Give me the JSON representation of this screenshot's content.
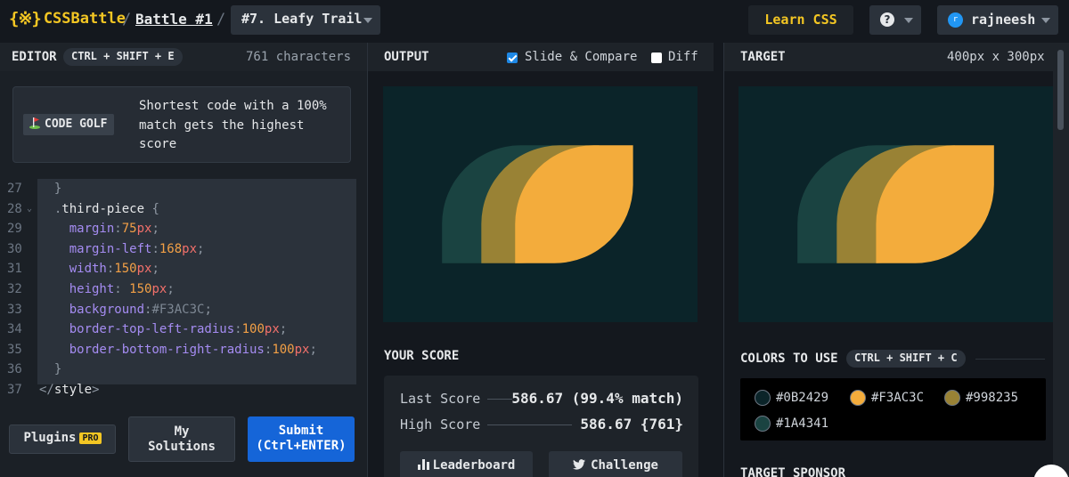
{
  "header": {
    "logo_mark": "{※}",
    "logo_text": "CSSBattle",
    "sep": "/",
    "battle_link": "Battle #1",
    "challenge_select": "#7. Leafy Trail",
    "learn_css": "Learn CSS",
    "help_symbol": "?",
    "avatar_initial": "r",
    "username": "rajneesh"
  },
  "editor": {
    "title": "EDITOR",
    "shortcut": "CTRL + SHIFT + E",
    "char_count": "761 characters",
    "golf_badge": "CODE GOLF",
    "golf_text": "Shortest code with a 100% match gets the highest score",
    "code_lines": [
      {
        "num": "27",
        "text": "  }"
      },
      {
        "num": "28",
        "text": "  .third-piece {"
      },
      {
        "num": "29",
        "text": "    margin:75px;"
      },
      {
        "num": "30",
        "text": "    margin-left:168px;"
      },
      {
        "num": "31",
        "text": "    width:150px;"
      },
      {
        "num": "32",
        "text": "    height: 150px;"
      },
      {
        "num": "33",
        "text": "    background:#F3AC3C;"
      },
      {
        "num": "34",
        "text": "    border-top-left-radius:100px;"
      },
      {
        "num": "35",
        "text": "    border-bottom-right-radius:100px;"
      },
      {
        "num": "36",
        "text": "  }"
      },
      {
        "num": "37",
        "text": "</style>"
      }
    ],
    "plugins_label": "Plugins",
    "pro_label": "PRO",
    "my_solutions_line1": "My",
    "my_solutions_line2": "Solutions",
    "submit_line1": "Submit",
    "submit_line2": "(Ctrl+ENTER)"
  },
  "output": {
    "title": "OUTPUT",
    "slide_compare": "Slide & Compare",
    "slide_compare_checked": true,
    "diff": "Diff",
    "diff_checked": false
  },
  "score": {
    "title": "YOUR SCORE",
    "last_label": "Last Score",
    "last_value": "586.67 (99.4% match)",
    "high_label": "High Score",
    "high_value": "586.67 {761}",
    "leaderboard": "Leaderboard",
    "challenge": "Challenge"
  },
  "target": {
    "title": "TARGET",
    "size": "400px x 300px",
    "colors_title": "COLORS TO USE",
    "colors_shortcut": "CTRL + SHIFT + C",
    "colors": [
      {
        "hex": "#0B2429"
      },
      {
        "hex": "#F3AC3C"
      },
      {
        "hex": "#998235"
      },
      {
        "hex": "#1A4341"
      }
    ],
    "sponsor": "TARGET SPONSOR"
  }
}
